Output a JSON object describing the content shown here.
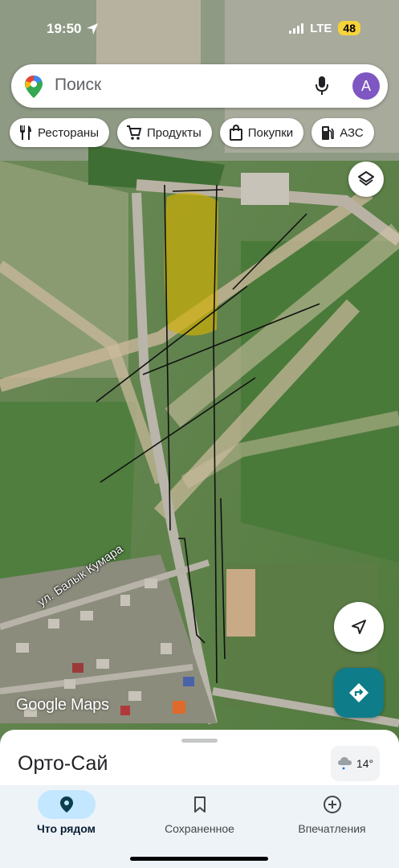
{
  "status": {
    "time": "19:50",
    "network": "LTE",
    "battery": "48"
  },
  "search": {
    "placeholder": "Поиск",
    "avatar_letter": "A"
  },
  "chips": [
    {
      "label": "Рестораны",
      "icon": "fork-knife-icon"
    },
    {
      "label": "Продукты",
      "icon": "cart-icon"
    },
    {
      "label": "Покупки",
      "icon": "shopping-bag-icon"
    },
    {
      "label": "АЗС",
      "icon": "gas-station-icon"
    }
  ],
  "map": {
    "street_label": "ул. Балык Кумара",
    "attribution": "Google Maps"
  },
  "sheet": {
    "place_name": "Орто-Сай",
    "temperature": "14°"
  },
  "nav": [
    {
      "label": "Что рядом",
      "icon": "location-pin-icon",
      "active": true
    },
    {
      "label": "Сохраненное",
      "icon": "bookmark-icon",
      "active": false
    },
    {
      "label": "Впечатления",
      "icon": "add-circle-icon",
      "active": false
    }
  ],
  "colors": {
    "accent": "#0f7c89",
    "active_tab_bg": "#c2e7ff",
    "avatar": "#7e57c2",
    "highlight": "#d4b000"
  }
}
